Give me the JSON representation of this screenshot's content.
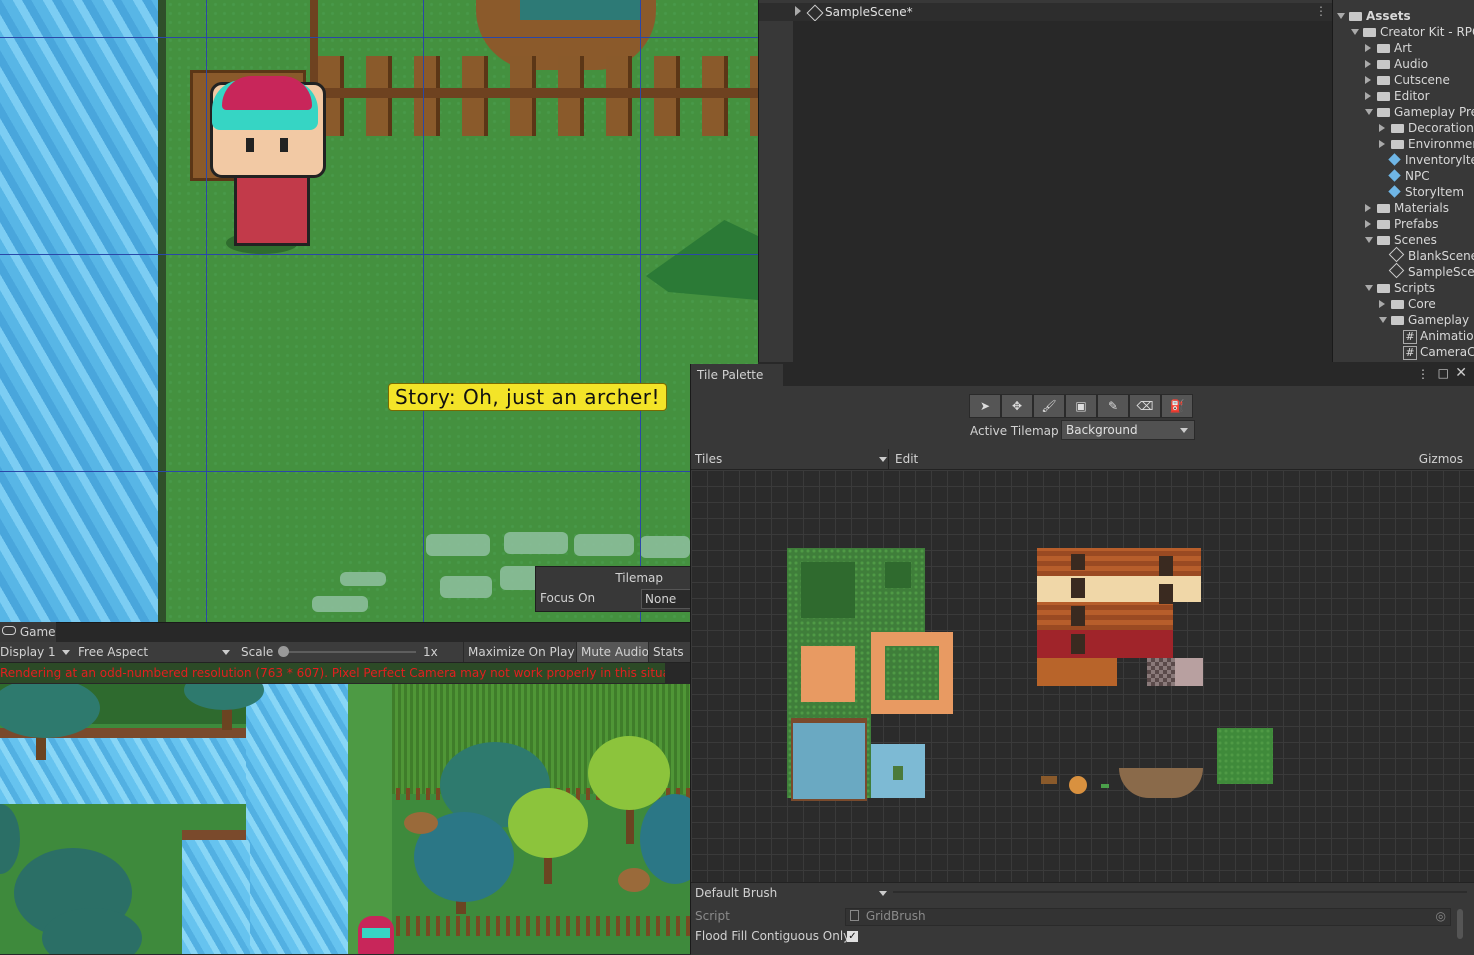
{
  "scene": {
    "story_text": "Story: Oh, just an archer!",
    "overlay_title": "Tilemap",
    "focus_label": "Focus On",
    "focus_value": "None"
  },
  "game": {
    "tab_label": "Game",
    "display": "Display 1",
    "aspect": "Free Aspect",
    "scale_label": "Scale",
    "scale_value": "1x",
    "maximize": "Maximize On Play",
    "mute": "Mute Audio",
    "stats": "Stats",
    "warning": "Rendering at an odd-numbered resolution (763 * 607). Pixel Perfect Camera may not work properly in this situation."
  },
  "hierarchy": {
    "scene_name": "SampleScene*"
  },
  "project": {
    "items": [
      {
        "label": "Assets",
        "type": "folder-open",
        "depth": 0,
        "bold": true
      },
      {
        "label": "Creator Kit - RPG",
        "type": "folder-open",
        "depth": 1
      },
      {
        "label": "Art",
        "type": "folder",
        "depth": 2
      },
      {
        "label": "Audio",
        "type": "folder",
        "depth": 2
      },
      {
        "label": "Cutscene",
        "type": "folder",
        "depth": 2
      },
      {
        "label": "Editor",
        "type": "folder",
        "depth": 2
      },
      {
        "label": "Gameplay Prefabs",
        "type": "folder-open",
        "depth": 2
      },
      {
        "label": "Decorations",
        "type": "folder",
        "depth": 3
      },
      {
        "label": "Environment",
        "type": "folder",
        "depth": 3
      },
      {
        "label": "InventoryItem",
        "type": "prefab",
        "depth": 3
      },
      {
        "label": "NPC",
        "type": "prefab",
        "depth": 3
      },
      {
        "label": "StoryItem",
        "type": "prefab",
        "depth": 3
      },
      {
        "label": "Materials",
        "type": "folder",
        "depth": 2
      },
      {
        "label": "Prefabs",
        "type": "folder",
        "depth": 2
      },
      {
        "label": "Scenes",
        "type": "folder-open",
        "depth": 2
      },
      {
        "label": "BlankScene",
        "type": "scene",
        "depth": 3
      },
      {
        "label": "SampleScene",
        "type": "scene",
        "depth": 3
      },
      {
        "label": "Scripts",
        "type": "folder-open",
        "depth": 2
      },
      {
        "label": "Core",
        "type": "folder",
        "depth": 3
      },
      {
        "label": "Gameplay",
        "type": "folder-open",
        "depth": 3
      },
      {
        "label": "AnimationController",
        "type": "script",
        "depth": 4
      },
      {
        "label": "CameraController",
        "type": "script",
        "depth": 4
      }
    ]
  },
  "tile_palette": {
    "tab_label": "Tile Palette",
    "active_tilemap_label": "Active Tilemap",
    "active_tilemap_value": "Background",
    "palette_select": "Tiles",
    "edit_label": "Edit",
    "gizmos_label": "Gizmos",
    "brush_select": "Default Brush",
    "script_label": "Script",
    "script_value": "GridBrush",
    "flood_label": "Flood Fill Contiguous Only",
    "flood_checked": "✓",
    "tools": [
      {
        "name": "select-tool",
        "glyph": "➤"
      },
      {
        "name": "move-tool",
        "glyph": "✥"
      },
      {
        "name": "paint-brush-tool",
        "glyph": "🖌"
      },
      {
        "name": "box-fill-tool",
        "glyph": "▣"
      },
      {
        "name": "picker-tool",
        "glyph": "✎"
      },
      {
        "name": "eraser-tool",
        "glyph": "⌫"
      },
      {
        "name": "flood-fill-tool",
        "glyph": "⛽"
      }
    ]
  },
  "colors": {
    "accent_story": "#f3e428",
    "warning_red": "#e21f1f",
    "panel_bg": "#383838"
  }
}
